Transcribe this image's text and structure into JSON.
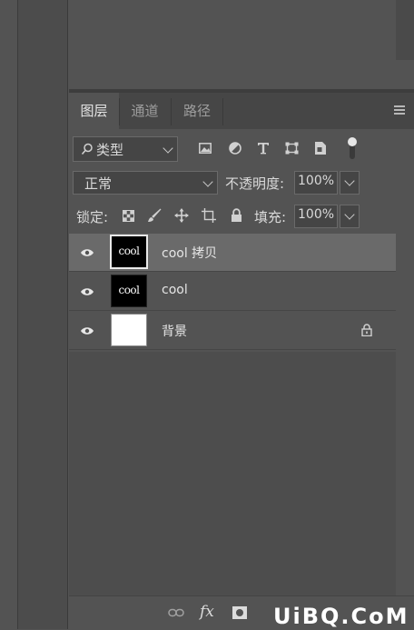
{
  "layers_panel": {
    "tabs": [
      {
        "label": "图层",
        "active": true
      },
      {
        "label": "通道",
        "active": false
      },
      {
        "label": "路径",
        "active": false
      }
    ],
    "filter": {
      "search_icon": "magnifier-icon",
      "kind_label": "类型",
      "filter_icons": [
        "image-filter-icon",
        "adjustment-filter-icon",
        "type-filter-icon",
        "shape-filter-icon",
        "smart-object-filter-icon",
        "filter-toggle-icon"
      ]
    },
    "blend_mode": "正常",
    "opacity_label": "不透明度:",
    "opacity_value": "100%",
    "lock_label": "锁定:",
    "lock_icons": [
      "lock-transparent-icon",
      "lock-image-icon",
      "lock-position-icon",
      "lock-artboard-icon",
      "lock-all-icon"
    ],
    "fill_label": "填充:",
    "fill_value": "100%",
    "layers": [
      {
        "name": "cool 拷贝",
        "thumb_text": "cool",
        "thumb": "dark",
        "visible": true,
        "selected": true,
        "locked": false
      },
      {
        "name": "cool",
        "thumb_text": "cool",
        "thumb": "dark",
        "visible": true,
        "selected": false,
        "locked": false
      },
      {
        "name": "背景",
        "thumb_text": "",
        "thumb": "white",
        "visible": true,
        "selected": false,
        "locked": true
      }
    ],
    "footer_icons": [
      "link-icon",
      "fx-icon",
      "mask-icon"
    ],
    "footer_fx_label": "fx"
  },
  "watermark": "UiBQ.CoM",
  "colors": {
    "panel": "#535353",
    "tab_bar": "#464646",
    "selected_row": "#6a6a6a",
    "field": "#454545"
  }
}
